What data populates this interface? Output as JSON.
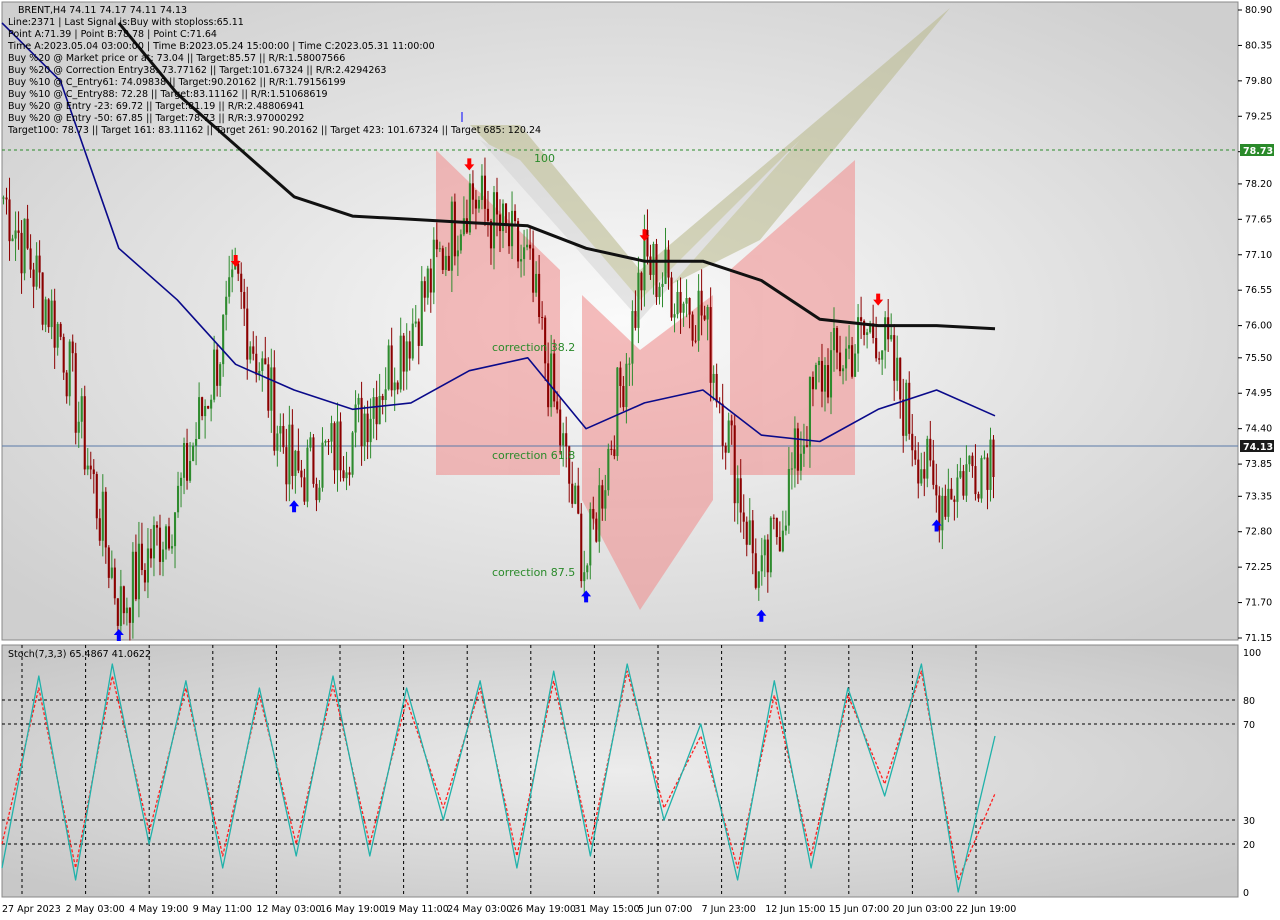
{
  "header": {
    "symbol_line": "BRENT,H4  74.11 74.17 74.11 74.13",
    "lines": [
      "Line:2371  |  Last Signal is:Buy with stoploss:65.11",
      "Point A:71.39  |  Point B:78.78  |  Point C:71.64",
      "Time A:2023.05.04 03:00:00  |  Time B:2023.05.24 15:00:00  |  Time C:2023.05.31 11:00:00",
      "Buy %20 @ Market price or at: 73.04  ||  Target:85.57  ||  R/R:1.58007566",
      "Buy %20 @ Correction Entry38: 73.77162  ||  Target:101.67324  ||  R/R:2.4294263",
      "Buy %10 @ C_Entry61: 74.09838  ||  Target:90.20162  ||  R/R:1.79156199",
      "Buy %10 @ C_Entry88: 72.28  ||  Target:83.11162  ||  R/R:1.51068619",
      "Buy %20 @ Entry -23: 69.72  ||  Target:81.19  ||  R/R:2.48806941",
      "Buy %20 @ Entry -50: 67.85  ||  Target:78.73  ||  R/R:3.97000292",
      "Target100: 78.73  ||  Target 161: 83.11162  ||  Target 261: 90.20162  ||  Target 423: 101.67324  ||  Target 685: 120.24"
    ]
  },
  "price_axis": {
    "ticks": [
      "80.90",
      "80.35",
      "79.80",
      "79.25",
      "78.70",
      "78.20",
      "77.65",
      "77.10",
      "76.55",
      "76.00",
      "75.50",
      "74.95",
      "74.40",
      "73.85",
      "73.35",
      "72.80",
      "72.25",
      "71.70",
      "71.15"
    ],
    "current_price": "74.13",
    "target_price": "78.73"
  },
  "correction_labels": {
    "c100": "100",
    "c382": "correction 38.2",
    "c618": "correction 61.8",
    "c875": "correction 87.5"
  },
  "stoch": {
    "title": "Stoch(7,3,3) 65.4867 41.0622",
    "ticks": [
      "100",
      "80",
      "70",
      "30",
      "20",
      "0"
    ]
  },
  "time_axis": {
    "labels": [
      "27 Apr 2023",
      "2 May 03:00",
      "4 May 19:00",
      "9 May 11:00",
      "12 May 03:00",
      "16 May 19:00",
      "19 May 11:00",
      "24 May 03:00",
      "26 May 19:00",
      "31 May 15:00",
      "5 Jun 07:00",
      "7 Jun 23:00",
      "12 Jun 15:00",
      "15 Jun 07:00",
      "20 Jun 03:00",
      "22 Jun 19:00"
    ]
  },
  "colors": {
    "bull": "#2e8b2e",
    "bear": "#8b0000",
    "ma_fast": "#0a0a8a",
    "ma_slow": "#111111",
    "signal_up": "#0000ff",
    "signal_down": "#ff0000",
    "zone_red": "#f2a0a0",
    "stoch_main": "#20b2aa",
    "stoch_signal": "#ff2020"
  },
  "chart_data": [
    {
      "type": "candlestick",
      "symbol": "BRENT",
      "timeframe": "H4",
      "ylim": [
        71.15,
        80.9
      ],
      "last": 74.13,
      "points": {
        "A": 71.39,
        "B": 78.78,
        "C": 71.64
      },
      "target100": 78.73,
      "close_path": [
        {
          "t": "27 Apr 2023",
          "v": 78.0
        },
        {
          "t": "2 May 03:00",
          "v": 75.8
        },
        {
          "t": "4 May 03:00",
          "v": 71.6
        },
        {
          "t": "4 May 19:00",
          "v": 73.3
        },
        {
          "t": "9 May 11:00",
          "v": 76.6
        },
        {
          "t": "12 May 03:00",
          "v": 73.6
        },
        {
          "t": "16 May 19:00",
          "v": 74.3
        },
        {
          "t": "19 May 11:00",
          "v": 76.0
        },
        {
          "t": "24 May 03:00",
          "v": 78.1
        },
        {
          "t": "26 May 19:00",
          "v": 76.9
        },
        {
          "t": "31 May 15:00",
          "v": 72.2
        },
        {
          "t": "5 Jun 07:00",
          "v": 77.0
        },
        {
          "t": "7 Jun 23:00",
          "v": 76.2
        },
        {
          "t": "12 Jun 15:00",
          "v": 71.9
        },
        {
          "t": "15 Jun 07:00",
          "v": 75.2
        },
        {
          "t": "20 Jun 03:00",
          "v": 76.0
        },
        {
          "t": "22 Jun 19:00",
          "v": 73.3
        },
        {
          "t": "latest",
          "v": 74.13
        }
      ],
      "series": [
        {
          "name": "MA slow",
          "values": [
            null,
            null,
            80.7,
            79.6,
            78.8,
            78.0,
            77.7,
            77.65,
            77.6,
            77.55,
            77.2,
            77.0,
            77.0,
            76.7,
            76.1,
            76.0,
            76.0,
            75.95
          ]
        },
        {
          "name": "MA fast",
          "values": [
            80.7,
            79.8,
            77.2,
            76.4,
            75.4,
            75.0,
            74.7,
            74.8,
            75.3,
            75.5,
            74.4,
            74.8,
            75.0,
            74.3,
            74.2,
            74.7,
            75.0,
            74.6
          ]
        }
      ]
    },
    {
      "type": "line",
      "title": "Stoch(7,3,3) 65.4867 41.0622",
      "ylim": [
        0,
        100
      ],
      "levels": [
        80,
        70,
        30,
        20
      ],
      "series": [
        {
          "name": "%K",
          "values": [
            10,
            90,
            5,
            95,
            20,
            88,
            10,
            85,
            15,
            90,
            15,
            85,
            30,
            88,
            10,
            92,
            15,
            95,
            30,
            70,
            5,
            88,
            10,
            85,
            40,
            95,
            0,
            65
          ]
        },
        {
          "name": "%D",
          "values": [
            20,
            85,
            10,
            90,
            25,
            85,
            15,
            82,
            20,
            86,
            20,
            80,
            35,
            85,
            15,
            88,
            20,
            92,
            35,
            65,
            10,
            82,
            15,
            82,
            45,
            92,
            5,
            41
          ]
        }
      ]
    }
  ]
}
